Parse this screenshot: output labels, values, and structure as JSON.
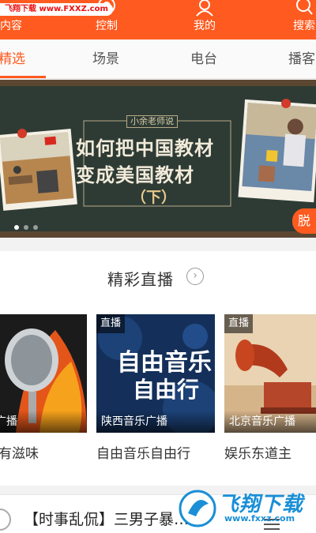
{
  "watermark_top": "飞翔下载 www.FXXZ.com",
  "top_nav": {
    "content_label": "内容",
    "control_label": "控制",
    "mine_label": "我的",
    "search_label": "搜索"
  },
  "tabs": [
    {
      "label": "精选",
      "active": true
    },
    {
      "label": "场景",
      "active": false
    },
    {
      "label": "电台",
      "active": false
    },
    {
      "label": "播客",
      "active": false
    }
  ],
  "banner": {
    "subtitle": "小余老师说",
    "title_line1": "如何把中国教材",
    "title_line2": "变成美国教材",
    "title_line3": "（下）",
    "cta_label": "脱"
  },
  "live_section": {
    "title": "精彩直播",
    "cards": [
      {
        "badge": "",
        "station": "音乐广播",
        "title": "有滋味"
      },
      {
        "badge": "直播",
        "station": "陕西音乐广播",
        "title": "自由音乐自由行",
        "art_text1": "自由音乐",
        "art_text2": "自由行"
      },
      {
        "badge": "直播",
        "station": "北京音乐广播",
        "title": "娱乐东道主"
      }
    ]
  },
  "bottom_item": {
    "title": "【时事乱侃】三男子暴…"
  },
  "watermark_bottom": {
    "brand": "飞翔下载",
    "url": "www.fxxz.com"
  },
  "colors": {
    "accent": "#ff5a1f",
    "watermark_blue": "#1a8fd6"
  }
}
